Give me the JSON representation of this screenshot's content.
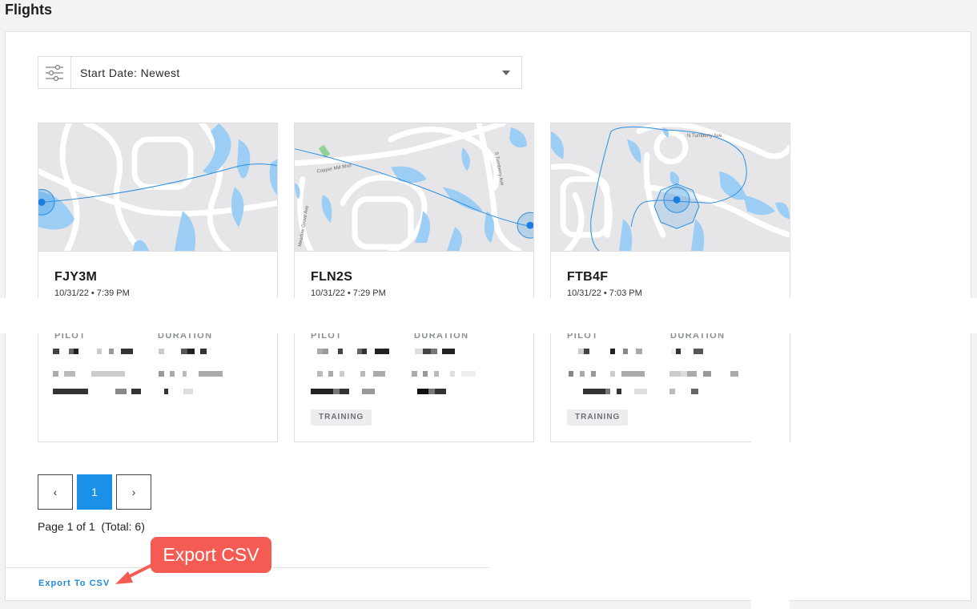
{
  "page": {
    "title": "Flights"
  },
  "filter": {
    "icon": "sliders-icon"
  },
  "sort": {
    "label": "Start Date: Newest"
  },
  "cards": [
    {
      "id": "FJY3M",
      "date": "10/31/22 • 7:39 PM",
      "pilot_label": "PILOT",
      "duration_label": "DURATION",
      "tag": ""
    },
    {
      "id": "FLN2S",
      "date": "10/31/22 • 7:29 PM",
      "pilot_label": "PILOT",
      "duration_label": "DURATION",
      "tag": "TRAINING"
    },
    {
      "id": "FTB4F",
      "date": "10/31/22 • 7:03 PM",
      "pilot_label": "PILOT",
      "duration_label": "DURATION",
      "tag": "TRAINING"
    }
  ],
  "maps": {
    "card2_labels": [
      "Copper Mill Blvd",
      "S Turnberry Ave",
      "Meadow Grove Ave"
    ],
    "card3_labels": [
      "N Turnberry Ave"
    ]
  },
  "pagination": {
    "prev": "‹",
    "current": "1",
    "next": "›",
    "info": "Page 1 of 1  (Total: 6)"
  },
  "export": {
    "link": "Export To CSV",
    "callout": "Export CSV"
  },
  "colors": {
    "accent": "#1a90e6",
    "callout": "#f45b52",
    "water": "#9ccdf5",
    "route": "#2a8fe0"
  }
}
